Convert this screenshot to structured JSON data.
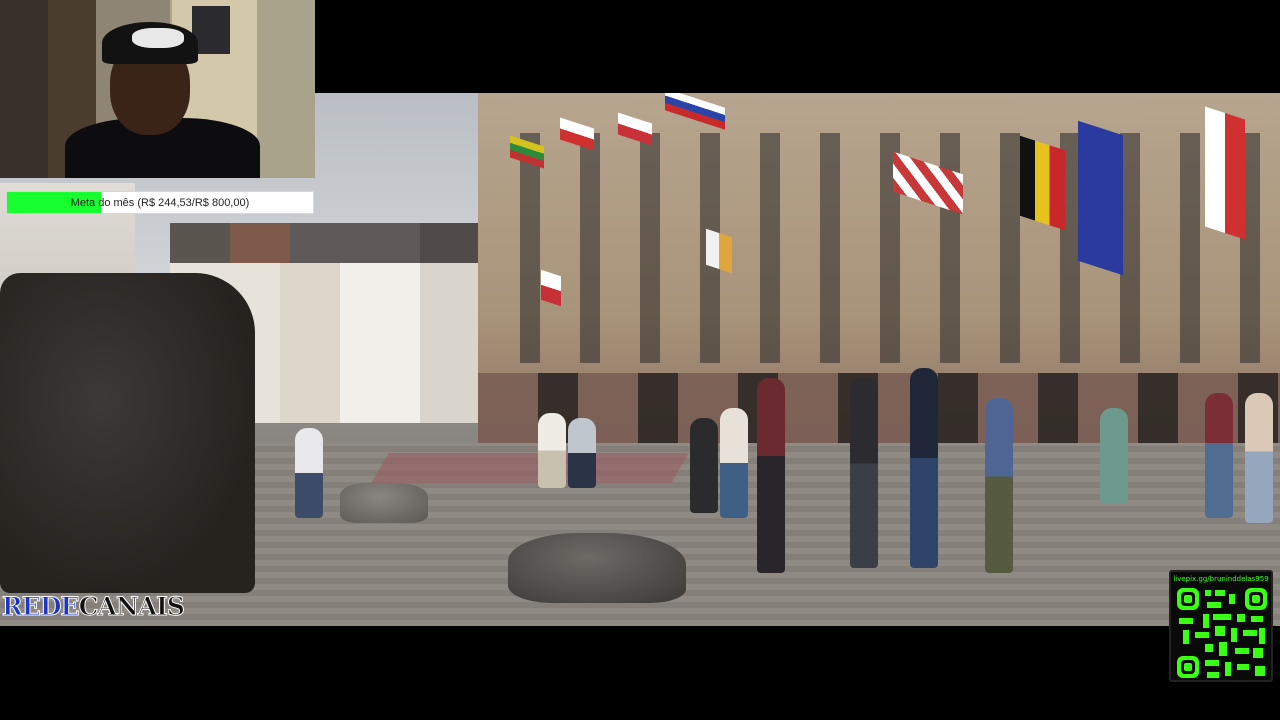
{
  "webcam": {
    "description_icon": "streamer-webcam"
  },
  "goal": {
    "label": "Meta do mês (R$ 244,53/R$ 800,00)",
    "current": 244.53,
    "target": 800.0,
    "fill_fraction": 0.3057,
    "fill_color": "#18ff2f"
  },
  "logo": {
    "part1": "REDE",
    "part2": "CANAIS",
    "color1": "#1e33c8",
    "color2": "#111111"
  },
  "qr": {
    "url": "livepix.gg/bruninddelas959",
    "color": "#39ff14"
  },
  "video": {
    "scene_icon": "video-frame"
  }
}
